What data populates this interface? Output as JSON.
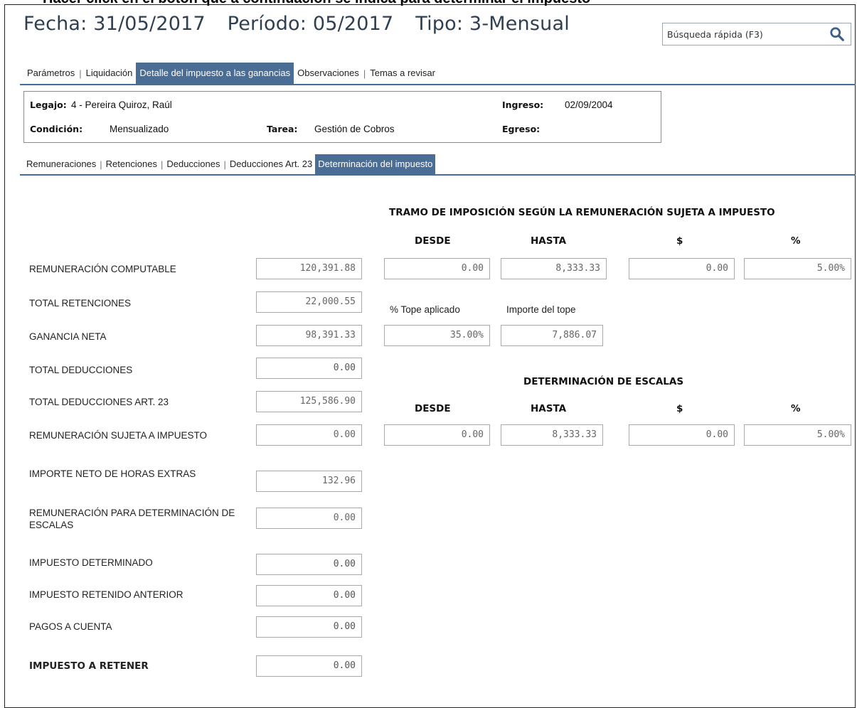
{
  "top_banner": "Hacer click en el botón que a continuación se indica para determinar el impuesto",
  "header": {
    "fecha": "Fecha: 31/05/2017",
    "periodo": "Período: 05/2017",
    "tipo": "Tipo: 3-Mensual"
  },
  "search": {
    "placeholder": "Búsqueda rápida (F3)",
    "icon": "search-icon"
  },
  "tabs_main": [
    {
      "label": "Parámetros",
      "active": false
    },
    {
      "label": "Liquidación",
      "active": false
    },
    {
      "label": "Detalle del impuesto a las ganancias",
      "active": true
    },
    {
      "label": "Observaciones",
      "active": false
    },
    {
      "label": "Temas a revisar",
      "active": false
    }
  ],
  "employee": {
    "legajo_label": "Legajo:",
    "legajo_value": "4 - Pereira Quiroz, Raúl",
    "ingreso_label": "Ingreso:",
    "ingreso_value": "02/09/2004",
    "condicion_label": "Condición:",
    "condicion_value": "Mensualizado",
    "tarea_label": "Tarea:",
    "tarea_value": "Gestión de Cobros",
    "egreso_label": "Egreso:",
    "egreso_value": ""
  },
  "tabs_sub": [
    {
      "label": "Remuneraciones",
      "active": false
    },
    {
      "label": "Retenciones",
      "active": false
    },
    {
      "label": "Deducciones",
      "active": false
    },
    {
      "label": "Deducciones Art. 23",
      "active": false
    },
    {
      "label": "Determinación del impuesto",
      "active": true
    }
  ],
  "rows": [
    {
      "label": "REMUNERACIÓN COMPUTABLE",
      "value": "120,391.88"
    },
    {
      "label": "TOTAL RETENCIONES",
      "value": "22,000.55"
    },
    {
      "label": "GANANCIA NETA",
      "value": "98,391.33"
    },
    {
      "label": "TOTAL DEDUCCIONES",
      "value": "0.00"
    },
    {
      "label": "TOTAL DEDUCCIONES ART. 23",
      "value": "125,586.90"
    },
    {
      "label": "REMUNERACIÓN SUJETA A IMPUESTO",
      "value": "0.00"
    },
    {
      "label": "IMPORTE NETO DE HORAS EXTRAS",
      "value": "132.96"
    },
    {
      "label": "REMUNERACIÓN PARA DETERMINACIÓN DE ESCALAS",
      "value": "0.00"
    },
    {
      "label": "IMPUESTO DETERMINADO",
      "value": "0.00"
    },
    {
      "label": "IMPUESTO RETENIDO ANTERIOR",
      "value": "0.00"
    },
    {
      "label": "PAGOS A CUENTA",
      "value": "0.00"
    },
    {
      "label": "IMPUESTO A RETENER",
      "value": "0.00"
    }
  ],
  "tramo": {
    "title": "TRAMO DE IMPOSICIÓN SEGÚN LA REMUNERACIÓN SUJETA A IMPUESTO",
    "col_desde": "DESDE",
    "col_hasta": "HASTA",
    "col_pesos": "$",
    "col_pct": "%",
    "desde": "0.00",
    "hasta": "8,333.33",
    "pesos": "0.00",
    "pct": "5.00%"
  },
  "tope": {
    "pct_label": "% Tope aplicado",
    "importe_label": "Importe del tope",
    "pct_value": "35.00%",
    "importe_value": "7,886.07"
  },
  "escalas": {
    "title": "DETERMINACIÓN DE ESCALAS",
    "col_desde": "DESDE",
    "col_hasta": "HASTA",
    "col_pesos": "$",
    "col_pct": "%",
    "desde": "0.00",
    "hasta": "8,333.33",
    "pesos": "0.00",
    "pct": "5.00%"
  },
  "colors": {
    "accent": "#4a6d96",
    "title_text": "#2f3f52"
  }
}
